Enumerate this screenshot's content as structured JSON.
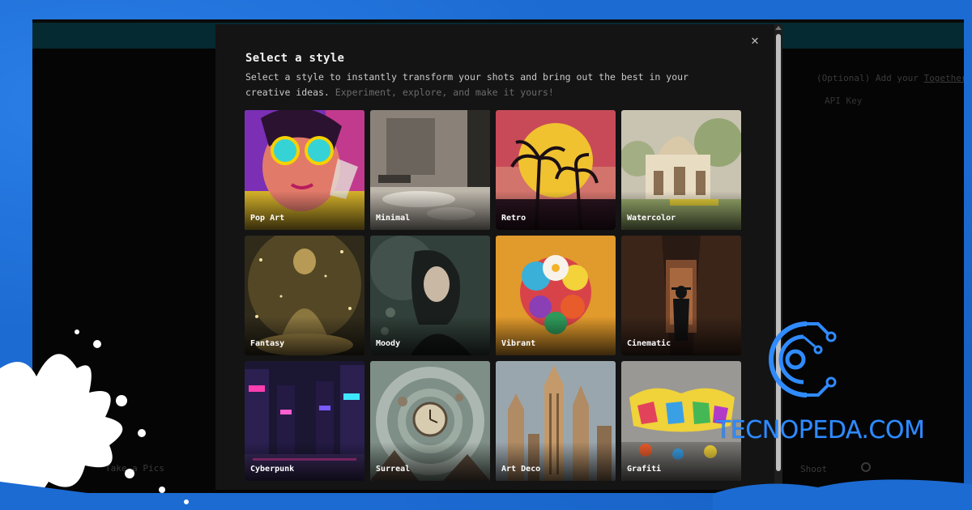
{
  "colors": {
    "frame": "#1c6bd3",
    "modal_bg": "#141414",
    "accent_watermark": "#2f8bff",
    "app_topbar": "#052a31"
  },
  "background_app": {
    "hint_prefix": "(Optional) Add your",
    "hint_link": "Together A",
    "api_key_placeholder": "API Key",
    "bottom_left": "Take a Pics",
    "bottom_right": "Shoot"
  },
  "modal": {
    "title": "Select a style",
    "description_main": "Select a style to instantly transform your shots and bring out the best in your creative ideas.",
    "description_muted": "Experiment, explore, and make it yours!",
    "close_icon": "close-icon",
    "styles": [
      {
        "label": "Pop Art",
        "selected": true
      },
      {
        "label": "Minimal",
        "selected": false
      },
      {
        "label": "Retro",
        "selected": false
      },
      {
        "label": "Watercolor",
        "selected": false
      },
      {
        "label": "Fantasy",
        "selected": false
      },
      {
        "label": "Moody",
        "selected": false
      },
      {
        "label": "Vibrant",
        "selected": false
      },
      {
        "label": "Cinematic",
        "selected": false
      },
      {
        "label": "Cyberpunk",
        "selected": false
      },
      {
        "label": "Surreal",
        "selected": false
      },
      {
        "label": "Art Deco",
        "selected": false
      },
      {
        "label": "Grafiti",
        "selected": false
      }
    ]
  },
  "watermark": {
    "text": "TECNOPEDA.COM",
    "logo_icon": "circuit-c-logo-icon"
  }
}
